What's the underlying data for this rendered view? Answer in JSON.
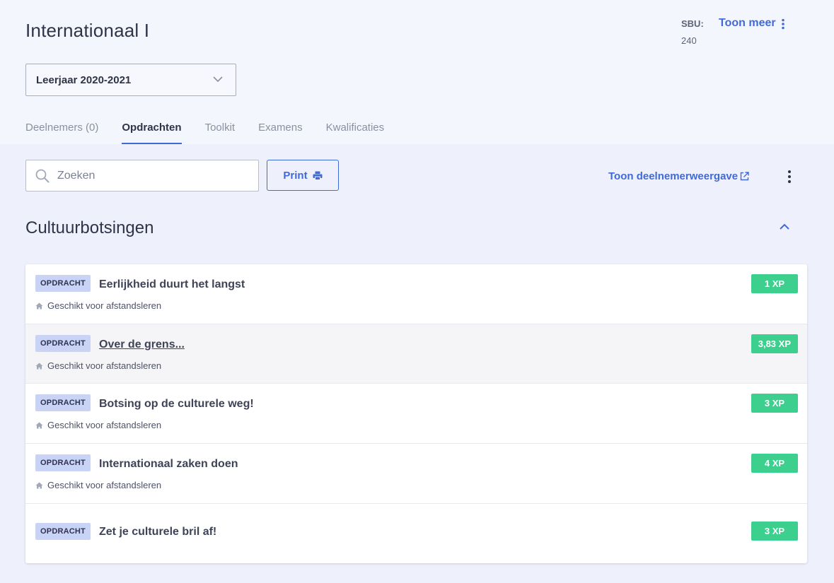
{
  "header": {
    "title": "Internationaal I",
    "sbu_label": "SBU:",
    "sbu_value": "240",
    "show_more": "Toon meer"
  },
  "year_select": {
    "value": "Leerjaar 2020-2021"
  },
  "tabs": [
    {
      "label": "Deelnemers (0)"
    },
    {
      "label": "Opdrachten"
    },
    {
      "label": "Toolkit"
    },
    {
      "label": "Examens"
    },
    {
      "label": "Kwalificaties"
    }
  ],
  "toolbar": {
    "search_placeholder": "Zoeken",
    "print_label": "Print",
    "participant_view_label": "Toon deelnemerweergave"
  },
  "section": {
    "title": "Cultuurbotsingen"
  },
  "assignments": [
    {
      "badge": "OPDRACHT",
      "title": "Eerlijkheid duurt het langst",
      "meta": "Geschikt voor afstandsleren",
      "xp": "1 XP"
    },
    {
      "badge": "OPDRACHT",
      "title": "Over de grens...",
      "meta": "Geschikt voor afstandsleren",
      "xp": "3,83 XP"
    },
    {
      "badge": "OPDRACHT",
      "title": "Botsing op de culturele weg!",
      "meta": "Geschikt voor afstandsleren",
      "xp": "3 XP"
    },
    {
      "badge": "OPDRACHT",
      "title": "Internationaal zaken doen",
      "meta": "Geschikt voor afstandsleren",
      "xp": "4 XP"
    },
    {
      "badge": "OPDRACHT",
      "title": "Zet je culturele bril af!",
      "xp": "3 XP"
    }
  ],
  "colors": {
    "accent": "#3f6ad8",
    "xp_green": "#3ccf8e",
    "badge_bg": "#c9d3f5"
  }
}
